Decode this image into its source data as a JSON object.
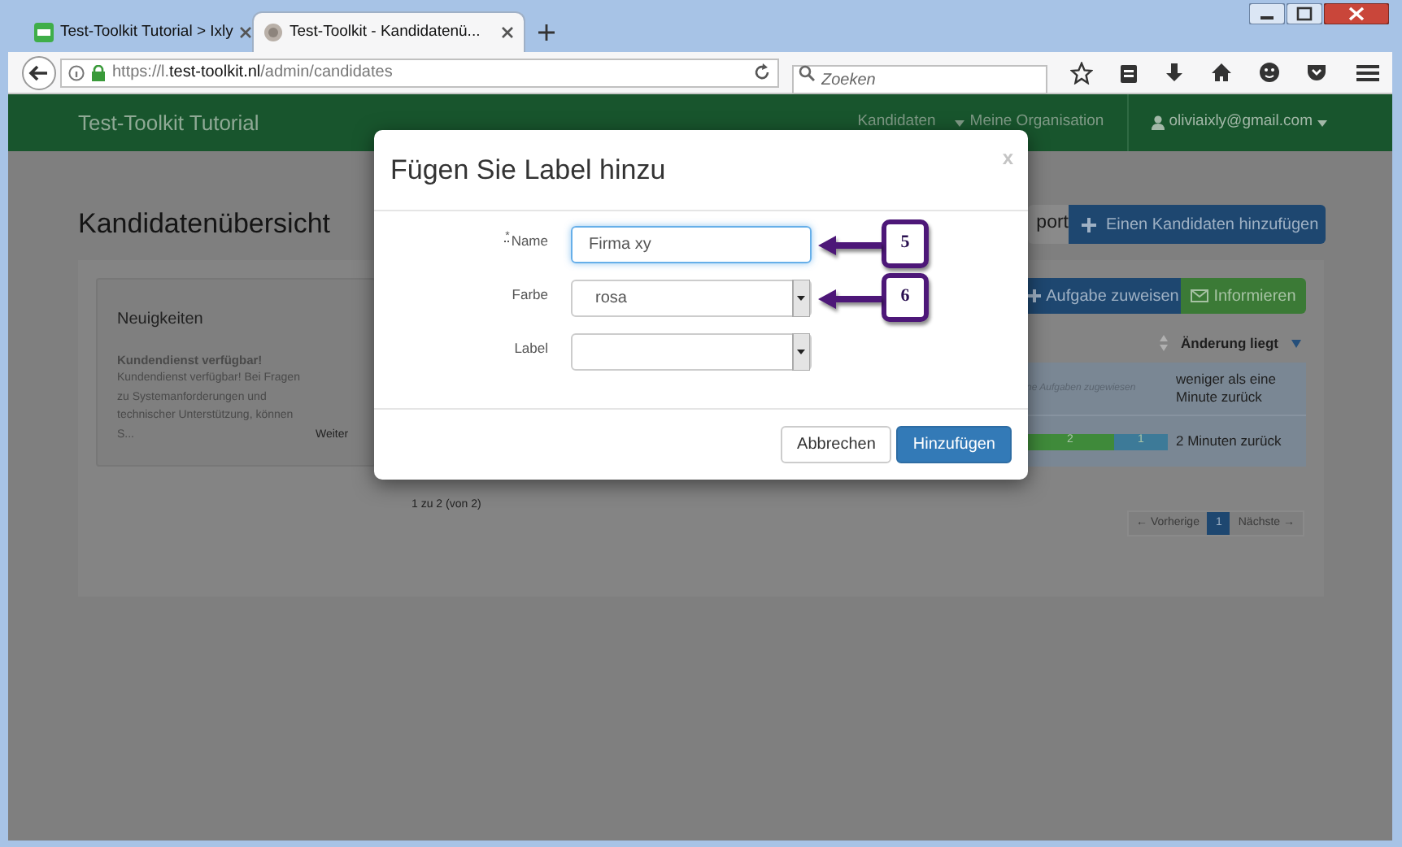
{
  "browser": {
    "tabs": [
      {
        "title": "Test-Toolkit Tutorial > Ixly",
        "selected": false
      },
      {
        "title": "Test-Toolkit - Kandidatenü...",
        "selected": true
      }
    ],
    "url": {
      "prefix": "https://l.",
      "domain": "test-toolkit.nl",
      "path": "/admin/candidates"
    },
    "search_placeholder": "Zoeken"
  },
  "navbar": {
    "brand": "Test-Toolkit Tutorial",
    "links": [
      "Kandidaten",
      "Meine Organisation"
    ],
    "user": "oliviaixly@gmail.com"
  },
  "page": {
    "title": "Kandidatenübersicht",
    "export_button": "port",
    "add_button": "Einen Kandidaten hinzufügen",
    "news": {
      "heading": "Neuigkeiten",
      "item_title": "Kundendienst verfügbar!",
      "item_text": "Kundendienst verfügbar! Bei Fragen zu Systemanforderungen und technischer Unterstützung, können S...",
      "more_link": "Weiter"
    },
    "actions": [
      {
        "kind": "assign",
        "label": "Aufgabe zuweisen"
      },
      {
        "kind": "inform",
        "label": "Informieren"
      }
    ],
    "table": {
      "column_header": "Änderung liegt",
      "rows": [
        {
          "kind": "status",
          "status": "ne Aufgaben zugewiesen",
          "changed": "weniger als eine Minute zurück"
        },
        {
          "kind": "progress",
          "segments": [
            {
              "label": "2",
              "color": "#3f8a3a",
              "level": 0.62
            },
            {
              "label": "1",
              "color": "#3d7a98",
              "level": 0.38
            }
          ],
          "changed": "2 Minuten zurück"
        }
      ]
    },
    "count": "1 zu 2 (von 2)",
    "pagination": [
      {
        "label": "← Vorherige",
        "selected": false
      },
      {
        "label": "1",
        "selected": true
      },
      {
        "label": "Nächste →",
        "selected": false
      }
    ]
  },
  "dialog": {
    "title": "Fügen Sie Label hinzu",
    "close": "x",
    "fields": [
      {
        "kind": "text",
        "label": "Name",
        "required_mark": "*",
        "value": "Firma xy",
        "focused": true,
        "callout": "5"
      },
      {
        "kind": "select",
        "label": "Farbe",
        "value": "rosa",
        "focused": false,
        "callout": "6"
      },
      {
        "kind": "select",
        "label": "Label",
        "focused": false
      }
    ],
    "buttons": [
      {
        "label": "Abbrechen",
        "primary": false
      },
      {
        "label": "Hinzufügen",
        "primary": true
      }
    ]
  }
}
